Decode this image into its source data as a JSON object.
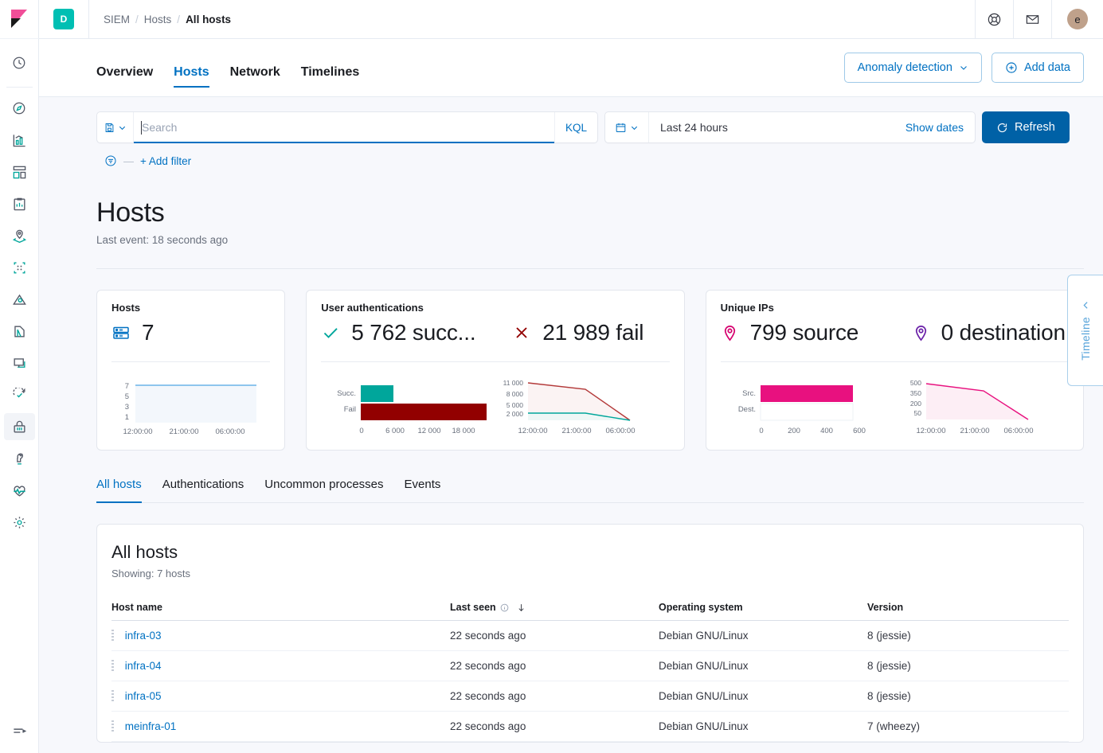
{
  "header": {
    "space_badge": "D",
    "breadcrumb": [
      "SIEM",
      "Hosts",
      "All hosts"
    ],
    "icons": [
      "help-lifering-icon",
      "mail-icon"
    ],
    "avatar_initial": "e"
  },
  "nav": {
    "logo": "kibana-logo",
    "items": [
      {
        "name": "recently-viewed",
        "icon": "clock-icon"
      },
      {
        "name": "discover",
        "icon": "compass-icon"
      },
      {
        "name": "visualize",
        "icon": "bar-chart-icon"
      },
      {
        "name": "dashboard",
        "icon": "dashboard-icon"
      },
      {
        "name": "canvas",
        "icon": "canvas-icon"
      },
      {
        "name": "maps",
        "icon": "map-marker-icon"
      },
      {
        "name": "machine-learning",
        "icon": "machine-learning-icon"
      },
      {
        "name": "infrastructure",
        "icon": "infrastructure-icon"
      },
      {
        "name": "logs",
        "icon": "logs-icon"
      },
      {
        "name": "apm",
        "icon": "apm-icon"
      },
      {
        "name": "uptime",
        "icon": "uptime-icon"
      },
      {
        "name": "siem",
        "icon": "lock-icon",
        "active": true
      },
      {
        "name": "dev-tools",
        "icon": "wrench-icon"
      },
      {
        "name": "monitoring",
        "icon": "heartbeat-icon"
      },
      {
        "name": "management",
        "icon": "gear-icon"
      }
    ],
    "collapse_icon": "collapse-arrow-icon"
  },
  "tabs": [
    {
      "label": "Overview",
      "active": false
    },
    {
      "label": "Hosts",
      "active": true
    },
    {
      "label": "Network",
      "active": false
    },
    {
      "label": "Timelines",
      "active": false
    }
  ],
  "header_actions": {
    "anomaly_detection": "Anomaly detection",
    "add_data": "Add data"
  },
  "search": {
    "placeholder": "Search",
    "value": "",
    "language": "KQL",
    "saved_query_icon": "saved-query-icon",
    "date_icon": "calendar-icon",
    "date_range": "Last 24 hours",
    "show_dates": "Show dates",
    "refresh": "Refresh",
    "add_filter": "+ Add filter",
    "filter_icon": "filter-icon"
  },
  "page": {
    "title": "Hosts",
    "subtitle": "Last event: 18 seconds ago"
  },
  "timeline_flyout": {
    "label": "Timeline",
    "chevron": "chevron-left-icon"
  },
  "stat_cards": [
    {
      "title": "Hosts",
      "stats": [
        {
          "icon": "server-icon",
          "icon_color": "#0071c2",
          "value": "7"
        }
      ]
    },
    {
      "title": "User authentications",
      "stats": [
        {
          "icon": "check-icon",
          "icon_color": "#00a69b",
          "value": "5 762 succ..."
        },
        {
          "icon": "cross-icon",
          "icon_color": "#920000",
          "value": "21 989 fail"
        }
      ]
    },
    {
      "title": "Unique IPs",
      "stats": [
        {
          "icon": "marker-icon",
          "icon_color": "#d6006e",
          "value": "799 source"
        },
        {
          "icon": "marker-icon",
          "icon_color": "#6b21a8",
          "value": "0 destination"
        }
      ]
    }
  ],
  "subtabs": [
    {
      "label": "All hosts",
      "active": true
    },
    {
      "label": "Authentications",
      "active": false
    },
    {
      "label": "Uncommon processes",
      "active": false
    },
    {
      "label": "Events",
      "active": false
    }
  ],
  "table": {
    "title": "All hosts",
    "showing": "Showing: 7 hosts",
    "columns": [
      {
        "label": "Host name",
        "info": false,
        "sorted": false
      },
      {
        "label": "Last seen",
        "info": true,
        "sorted": true,
        "sort_dir": "desc"
      },
      {
        "label": "Operating system",
        "info": false,
        "sorted": false
      },
      {
        "label": "Version",
        "info": false,
        "sorted": false
      }
    ],
    "rows": [
      {
        "host": "infra-03",
        "last_seen": "22 seconds ago",
        "os": "Debian GNU/Linux",
        "version": "8 (jessie)"
      },
      {
        "host": "infra-04",
        "last_seen": "22 seconds ago",
        "os": "Debian GNU/Linux",
        "version": "8 (jessie)"
      },
      {
        "host": "infra-05",
        "last_seen": "22 seconds ago",
        "os": "Debian GNU/Linux",
        "version": "8 (jessie)"
      },
      {
        "host": "meinfra-01",
        "last_seen": "22 seconds ago",
        "os": "Debian GNU/Linux",
        "version": "7 (wheezy)"
      }
    ]
  },
  "chart_data": [
    {
      "id": "hosts-area",
      "type": "area",
      "title": "Hosts over time",
      "xlabel": "",
      "ylabel": "",
      "x": [
        "12:00:00",
        "21:00:00",
        "06:00:00"
      ],
      "yticks": [
        7,
        5,
        3,
        1
      ],
      "ylim": [
        0,
        7
      ],
      "series": [
        {
          "name": "hosts",
          "color": "#6bb3e8",
          "values": [
            7,
            7,
            7,
            7
          ]
        }
      ],
      "grid": false,
      "legend": "none"
    },
    {
      "id": "auth-bar",
      "type": "bar",
      "title": "User authentications by outcome",
      "orientation": "horizontal",
      "categories": [
        "Succ.",
        "Fail"
      ],
      "values": [
        5762,
        21989
      ],
      "colors": [
        "#00a69b",
        "#920000"
      ],
      "xticks": [
        0,
        6000,
        12000,
        18000
      ],
      "xtick_labels": [
        "0",
        "6 000",
        "12 000",
        "18 000"
      ],
      "xlim": [
        0,
        24000
      ],
      "grid": false,
      "legend": "none"
    },
    {
      "id": "auth-area",
      "type": "area",
      "title": "Authentications over time",
      "x": [
        "12:00:00",
        "21:00:00",
        "06:00:00"
      ],
      "yticks": [
        11000,
        8000,
        5000,
        2000
      ],
      "ytick_labels": [
        "11 000",
        "8 000",
        "5 000",
        "2 000"
      ],
      "ylim": [
        0,
        11500
      ],
      "series": [
        {
          "name": "fail",
          "color": "#b33939",
          "values": [
            11000,
            9600,
            9300,
            400
          ]
        },
        {
          "name": "success",
          "color": "#00a69b",
          "values": [
            2400,
            2400,
            2400,
            400
          ]
        }
      ],
      "grid": false,
      "legend": "none"
    },
    {
      "id": "ips-bar",
      "type": "bar",
      "title": "Unique IPs by direction",
      "orientation": "horizontal",
      "categories": [
        "Src.",
        "Dest."
      ],
      "values": [
        799,
        0
      ],
      "colors": [
        "#e8117f",
        "#6b21a8"
      ],
      "xticks": [
        0,
        200,
        400,
        600
      ],
      "xtick_labels": [
        "0",
        "200",
        "400",
        "600"
      ],
      "xlim": [
        0,
        830
      ],
      "grid": false,
      "legend": "none"
    },
    {
      "id": "ips-area",
      "type": "area",
      "title": "Unique IPs over time",
      "x": [
        "12:00:00",
        "21:00:00",
        "06:00:00"
      ],
      "yticks": [
        500,
        350,
        200,
        50
      ],
      "ytick_labels": [
        "500",
        "350",
        "200",
        "50"
      ],
      "ylim": [
        0,
        540
      ],
      "series": [
        {
          "name": "source",
          "color": "#e8117f",
          "values": [
            500,
            440,
            420,
            60
          ]
        }
      ],
      "grid": false,
      "legend": "none"
    }
  ]
}
